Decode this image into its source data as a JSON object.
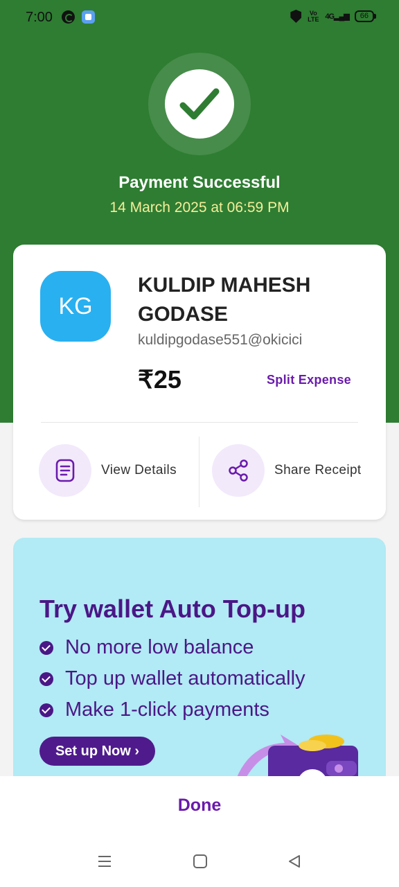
{
  "status_bar": {
    "time": "7:00",
    "network_label": "Vo LTE",
    "signal_label": "4G",
    "battery": "66"
  },
  "header": {
    "title": "Payment Successful",
    "datetime": "14 March 2025 at 06:59 PM"
  },
  "payee": {
    "initials": "KG",
    "name": "KULDIP MAHESH GODASE",
    "upi_id": "kuldipgodase551@okicici",
    "amount": "₹25",
    "split_label": "Split Expense"
  },
  "actions": {
    "view_details": "View Details",
    "share_receipt": "Share Receipt"
  },
  "promo": {
    "title": "Try wallet Auto Top-up",
    "bullets": [
      "No more low balance",
      "Top up wallet automatically",
      "Make 1-click payments"
    ],
    "cta": "Set up Now ›"
  },
  "footer": {
    "done_label": "Done"
  },
  "colors": {
    "header_green": "#2e7d32",
    "accent_purple": "#6a1bab",
    "avatar_blue": "#29b0f0",
    "promo_bg": "#b2eaf5"
  },
  "icons": [
    "check-icon",
    "document-icon",
    "share-icon",
    "menu-icon",
    "home-icon",
    "back-icon"
  ]
}
